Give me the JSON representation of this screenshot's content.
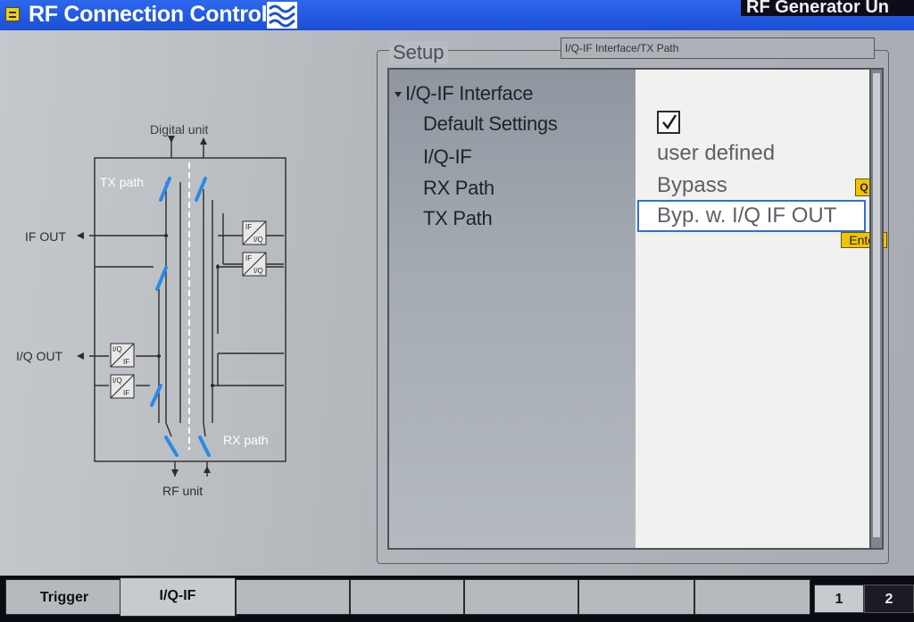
{
  "header": {
    "title": "RF Connection Control",
    "generator_tab": "RF Generator Un"
  },
  "diagram": {
    "digital_unit": "Digital unit",
    "tx_path": "TX path",
    "rx_path": "RX path",
    "if_out": "IF OUT",
    "iq_out": "I/Q OUT",
    "rf_unit": "RF unit",
    "conv_iq_if": {
      "top": "I/Q",
      "bottom": "IF"
    },
    "conv_if_iq": {
      "top": "IF",
      "bottom": "I/Q"
    }
  },
  "setup": {
    "label": "Setup",
    "path": "I/Q-IF Interface/TX Path",
    "tree": {
      "root": "I/Q-IF Interface",
      "items": [
        "Default Settings",
        "I/Q-IF",
        "RX Path",
        "TX Path"
      ]
    },
    "values": {
      "default_settings_checked": true,
      "iq_if": "user defined",
      "rx_path": "Bypass",
      "tx_path": "Byp. w. I/Q IF OUT"
    },
    "keys": {
      "q": "Q",
      "enter": "Enter"
    }
  },
  "tabs": [
    {
      "label": "Trigger",
      "active": false
    },
    {
      "label": "I/Q-IF",
      "active": true
    },
    {
      "label": "",
      "active": false
    },
    {
      "label": "",
      "active": false
    },
    {
      "label": "",
      "active": false
    },
    {
      "label": "",
      "active": false
    },
    {
      "label": "",
      "active": false
    }
  ],
  "pages": [
    "1",
    "2"
  ],
  "colors": {
    "title_bar": "#1b4fd6",
    "switch": "#2a8ae6",
    "selection_border": "#2f6fd6",
    "key_badge": "#f2c400"
  }
}
